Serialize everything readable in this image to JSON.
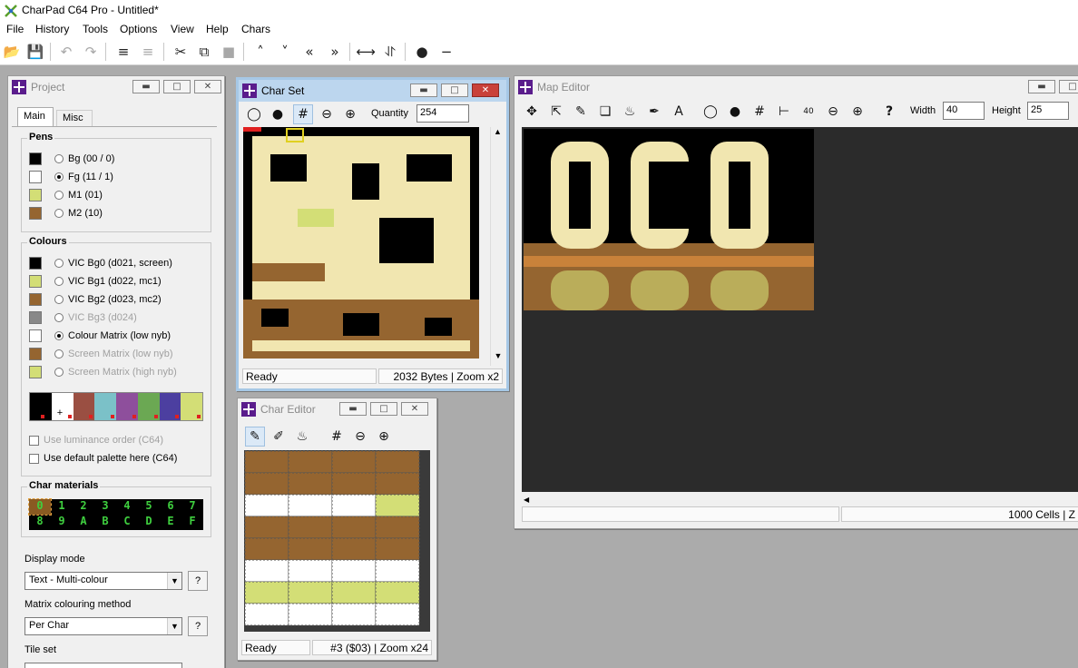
{
  "app": {
    "title": "CharPad C64 Pro - Untitled*"
  },
  "menu": [
    "File",
    "History",
    "Tools",
    "Options",
    "View",
    "Help",
    "Chars"
  ],
  "toolbar": {
    "icons": [
      "open-icon",
      "save-icon",
      "undo-icon",
      "redo-icon",
      "align-icon",
      "align-dim-icon",
      "cut-icon",
      "copy-icon",
      "paint-icon",
      "scroll-up-icon",
      "scroll-down-icon",
      "scroll-left-icon",
      "scroll-right-icon",
      "flip-h-icon",
      "flip-v-icon",
      "mirror-h-icon",
      "mirror-v-icon"
    ]
  },
  "project": {
    "title": "Project",
    "tabs": [
      "Main",
      "Misc"
    ],
    "pens_title": "Pens",
    "pens": [
      {
        "label": "Bg (00 / 0)",
        "color": "#000000",
        "checked": false
      },
      {
        "label": "Fg (11 / 1)",
        "color": "#ffffff",
        "checked": true
      },
      {
        "label": "M1 (01)",
        "color": "#d3de76",
        "checked": false
      },
      {
        "label": "M2 (10)",
        "color": "#956530",
        "checked": false
      }
    ],
    "colours_title": "Colours",
    "colours": [
      {
        "label": "VIC Bg0 (d021, screen)",
        "color": "#000000",
        "checked": false,
        "disabled": false
      },
      {
        "label": "VIC Bg1 (d022, mc1)",
        "color": "#d3de76",
        "checked": false,
        "disabled": false
      },
      {
        "label": "VIC Bg2 (d023, mc2)",
        "color": "#956530",
        "checked": false,
        "disabled": false
      },
      {
        "label": "VIC Bg3 (d024)",
        "color": "#888888",
        "checked": false,
        "disabled": true
      },
      {
        "label": "Colour Matrix (low nyb)",
        "color": "#ffffff",
        "checked": true,
        "disabled": false
      },
      {
        "label": "Screen Matrix (low nyb)",
        "color": "#956530",
        "checked": false,
        "disabled": true
      },
      {
        "label": "Screen Matrix (high nyb)",
        "color": "#d3de76",
        "checked": false,
        "disabled": true
      }
    ],
    "palette": [
      "#000000",
      "#ffffff",
      "#9a4f42",
      "#7bc1c8",
      "#8e4f9c",
      "#6ba853",
      "#4c3fa0",
      "#d3de76"
    ],
    "luminance_label": "Use luminance order (C64)",
    "default_palette_label": "Use default palette here (C64)",
    "materials_title": "Char materials",
    "materials_top": [
      "0",
      "1",
      "2",
      "3",
      "4",
      "5",
      "6",
      "7"
    ],
    "materials_bottom": [
      "8",
      "9",
      "A",
      "B",
      "C",
      "D",
      "E",
      "F"
    ],
    "display_mode_label": "Display mode",
    "display_mode_value": "Text - Multi-colour",
    "matrix_method_label": "Matrix colouring method",
    "matrix_method_value": "Per Char",
    "tileset_label": "Tile set",
    "help_label": "?"
  },
  "charset": {
    "title": "Char Set",
    "quantity_label": "Quantity",
    "quantity_value": "254",
    "status_left": "Ready",
    "status_right": "2032 Bytes | Zoom x2"
  },
  "chareditor": {
    "title": "Char Editor",
    "status_left": "Ready",
    "status_right": "#3 ($03) | Zoom x24",
    "pixels": [
      [
        2,
        2,
        2,
        2
      ],
      [
        2,
        2,
        2,
        2
      ],
      [
        1,
        1,
        1,
        3
      ],
      [
        2,
        2,
        2,
        2
      ],
      [
        2,
        2,
        2,
        2
      ],
      [
        1,
        1,
        1,
        1
      ],
      [
        3,
        3,
        3,
        3
      ],
      [
        1,
        1,
        1,
        1
      ]
    ],
    "pixel_colors": [
      "#000000",
      "#ffffff",
      "#956530",
      "#d3de76"
    ]
  },
  "mapeditor": {
    "title": "Map Editor",
    "width_label": "Width",
    "width_value": "40",
    "height_label": "Height",
    "height_value": "25",
    "help_label": "?",
    "status_right": "1000 Cells | Z"
  },
  "colors": {
    "brown": "#956530",
    "yellow": "#d3de76",
    "cream": "#f1e6b0",
    "orange": "#c9823a"
  }
}
